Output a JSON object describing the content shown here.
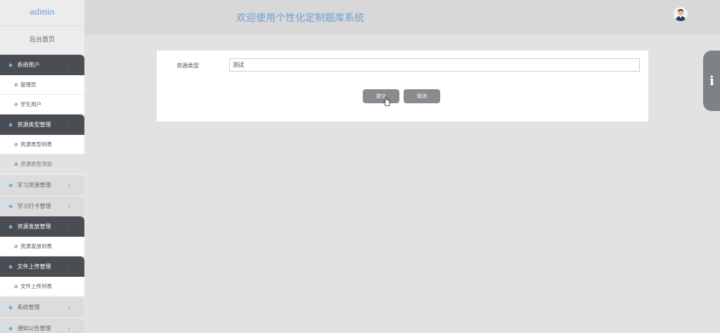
{
  "app": {
    "logo": "admin",
    "title": "欢迎使用个性化定制题库系统"
  },
  "sidebar": {
    "home": "后台首页",
    "groups": [
      {
        "label": "系统用户",
        "state": "open",
        "items": [
          "管理员",
          "学生用户"
        ]
      },
      {
        "label": "资源类型管理",
        "state": "open",
        "items": [
          "资源类型列表",
          "资源类型添加"
        ],
        "active_item": 1
      },
      {
        "label": "学习资源管理",
        "state": "closed"
      },
      {
        "label": "学习打卡管理",
        "state": "closed"
      },
      {
        "label": "资源发放管理",
        "state": "open",
        "items": [
          "资源发放列表"
        ]
      },
      {
        "label": "文件上传管理",
        "state": "open",
        "items": [
          "文件上传列表"
        ]
      },
      {
        "label": "系统管理",
        "state": "closed"
      },
      {
        "label": "通知公告管理",
        "state": "closed"
      }
    ]
  },
  "form": {
    "field_label": "资源类型",
    "field_value": "测试",
    "submit_label": "提交",
    "cancel_label": "取消"
  },
  "icons": {
    "group_icon": "gem-icon",
    "item_icon": "circle-check-icon",
    "side_tab": "info-icon"
  },
  "colors": {
    "accent_title": "#6f9fcf",
    "sidebar_open": "#4a4d51",
    "button": "#888b90",
    "gem": "#5db5e6"
  }
}
